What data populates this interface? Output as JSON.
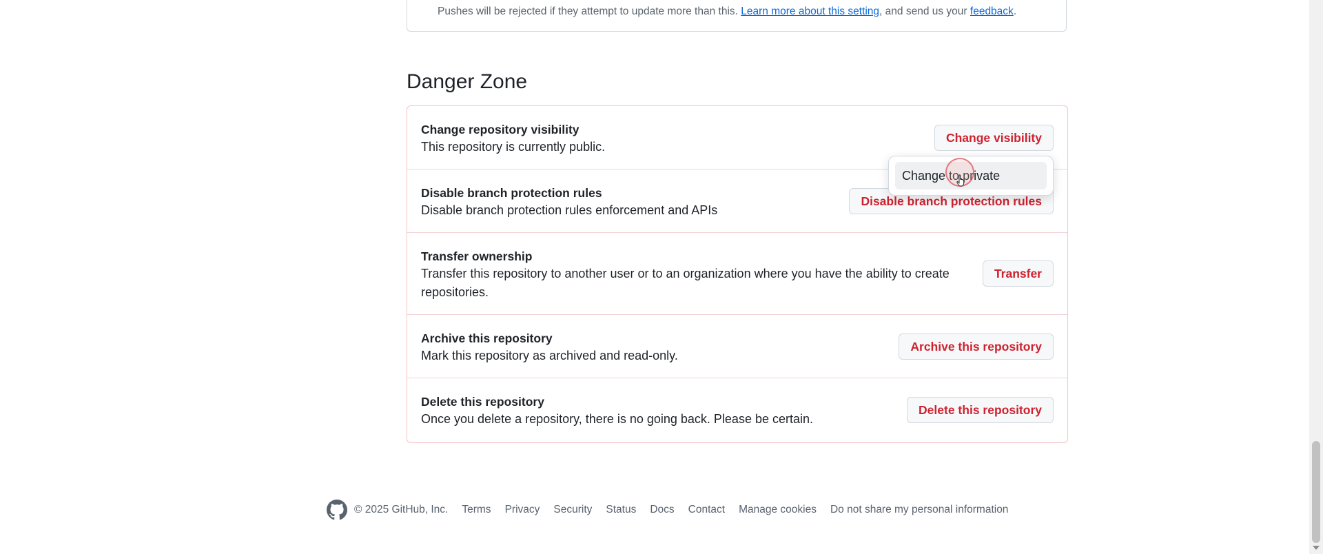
{
  "top_note": {
    "prefix": "Pushes will be rejected if they attempt to update more than this.",
    "link_learn": "Learn more about this setting",
    "middle": ", and send us your",
    "link_feedback": "feedback",
    "suffix": "."
  },
  "danger_zone": {
    "title": "Danger Zone",
    "rows": [
      {
        "title": "Change repository visibility",
        "desc": "This repository is currently public.",
        "button": "Change visibility"
      },
      {
        "title": "Disable branch protection rules",
        "desc": "Disable branch protection rules enforcement and APIs",
        "button": "Disable branch protection rules"
      },
      {
        "title": "Transfer ownership",
        "desc": "Transfer this repository to another user or to an organization where you have the ability to create repositories.",
        "button": "Transfer"
      },
      {
        "title": "Archive this repository",
        "desc": "Mark this repository as archived and read-only.",
        "button": "Archive this repository"
      },
      {
        "title": "Delete this repository",
        "desc": "Once you delete a repository, there is no going back. Please be certain.",
        "button": "Delete this repository"
      }
    ]
  },
  "visibility_menu": {
    "item": "Change to private"
  },
  "footer": {
    "copyright": "© 2025 GitHub, Inc.",
    "links": [
      "Terms",
      "Privacy",
      "Security",
      "Status",
      "Docs",
      "Contact",
      "Manage cookies",
      "Do not share my personal information"
    ]
  },
  "colors": {
    "danger": "#cf222e",
    "link": "#0969da",
    "muted": "#59636e"
  }
}
